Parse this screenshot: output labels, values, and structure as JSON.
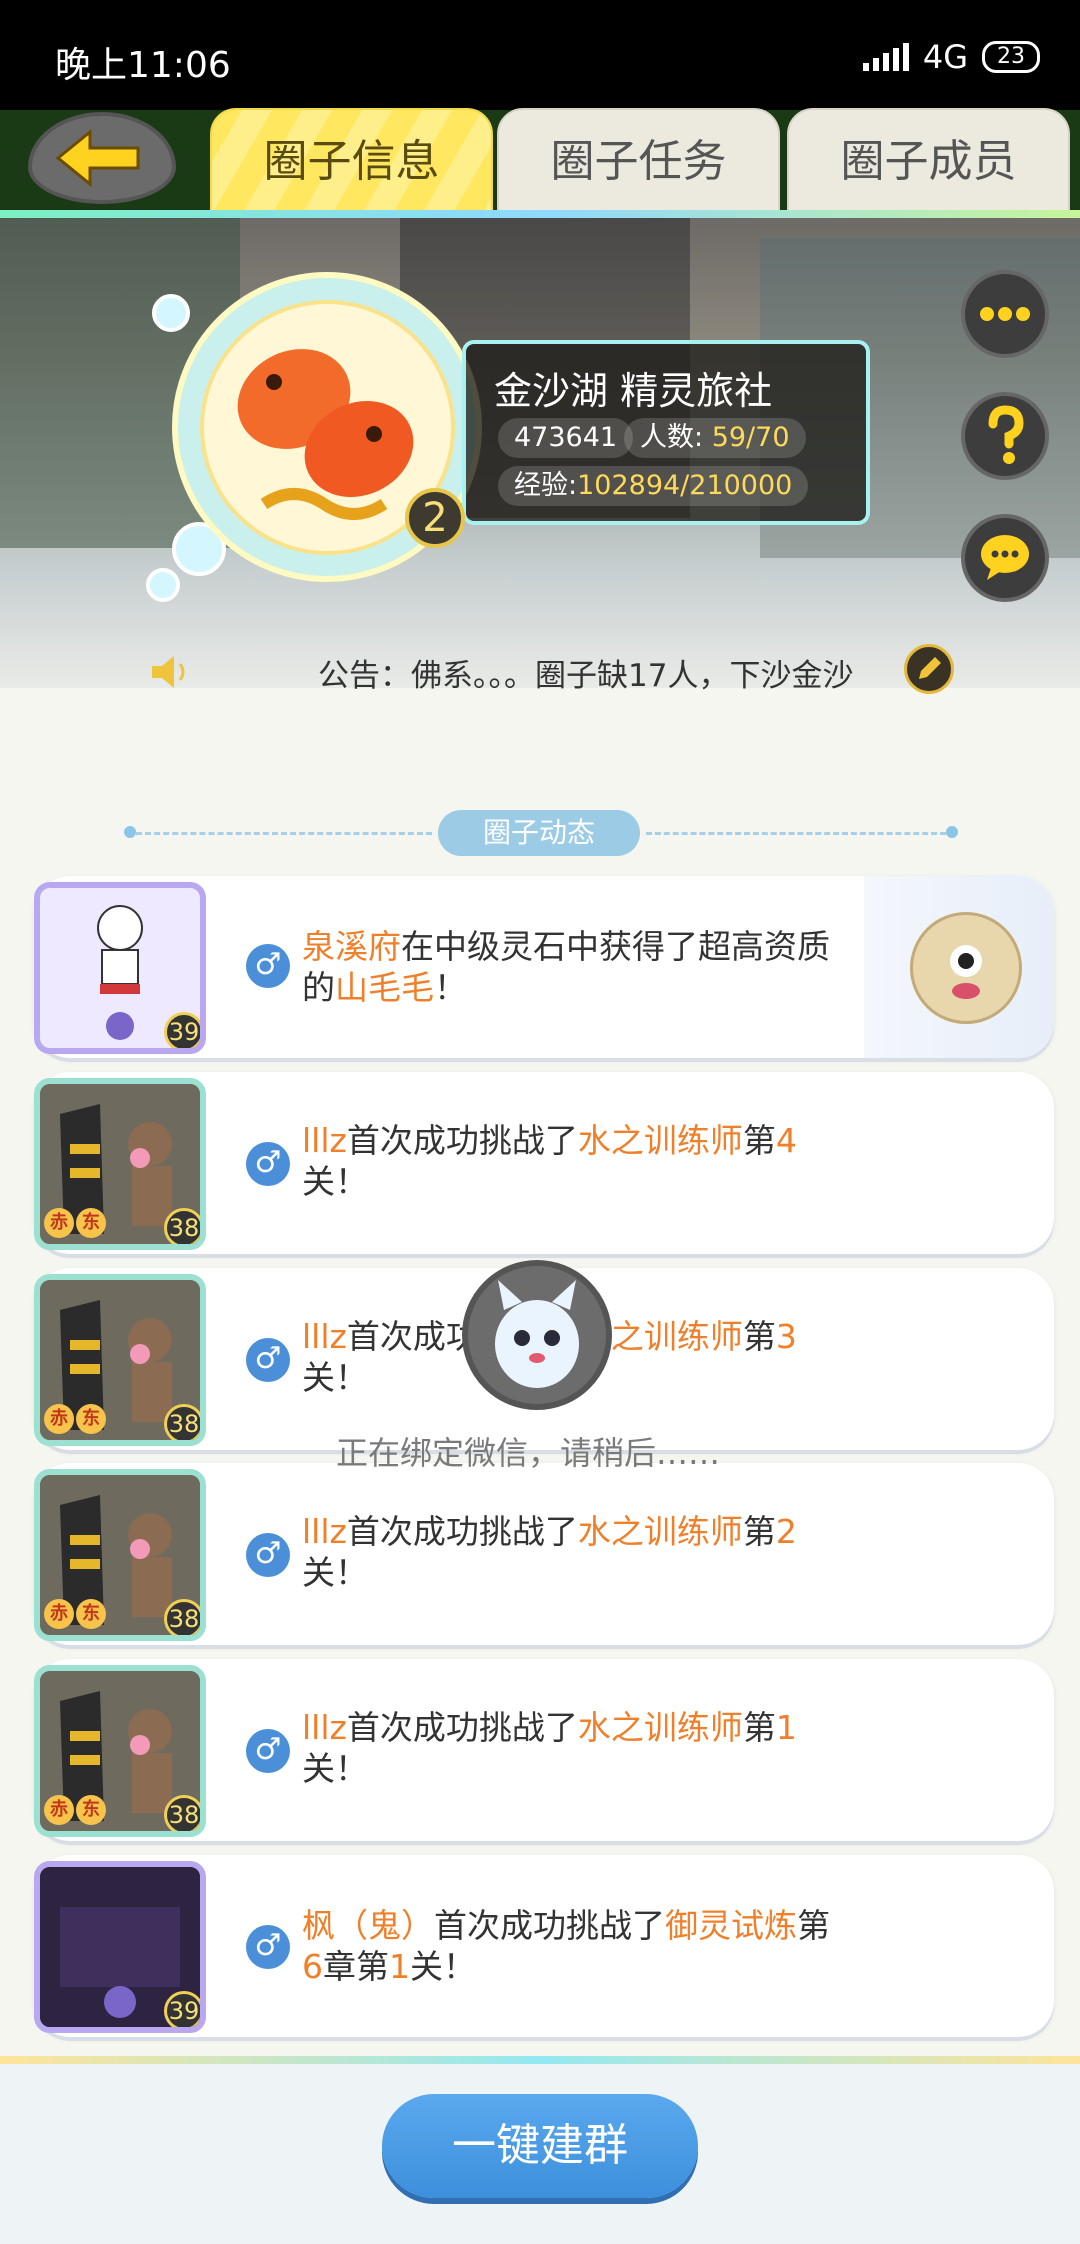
{
  "status_bar": {
    "time": "晚上11:06",
    "network": "4G",
    "battery": "23"
  },
  "tabs": [
    {
      "label": "圈子信息",
      "active": true
    },
    {
      "label": "圈子任务",
      "active": false
    },
    {
      "label": "圈子成员",
      "active": false
    }
  ],
  "club": {
    "level": "2",
    "name": "金沙湖 精灵旅社",
    "id": "473641",
    "members_label": "人数:",
    "members_value": "59/70",
    "exp_label": "经验:",
    "exp_value": "102894/210000",
    "notice": "公告：佛系。。。圈子缺17人，下沙金沙"
  },
  "section_title": "圈子动态",
  "feed": [
    {
      "level": "39",
      "parts": [
        [
          "泉溪府",
          true
        ],
        [
          "在中级灵石中获得了超高资质的",
          false
        ],
        [
          "山毛毛",
          true
        ],
        [
          "！",
          false
        ]
      ]
    },
    {
      "level": "38",
      "parts": [
        [
          "lllz",
          true
        ],
        [
          "首次成功挑战了",
          false
        ],
        [
          "水之训练师",
          true
        ],
        [
          "第",
          false
        ],
        [
          "4",
          true
        ],
        [
          "关！",
          false
        ]
      ]
    },
    {
      "level": "38",
      "parts": [
        [
          "lllz",
          true
        ],
        [
          "首次成功挑战了",
          false
        ],
        [
          "水之训练师",
          true
        ],
        [
          "第",
          false
        ],
        [
          "3",
          true
        ],
        [
          "关！",
          false
        ]
      ]
    },
    {
      "level": "38",
      "parts": [
        [
          "lllz",
          true
        ],
        [
          "首次成功挑战了",
          false
        ],
        [
          "水之训练师",
          true
        ],
        [
          "第",
          false
        ],
        [
          "2",
          true
        ],
        [
          "关！",
          false
        ]
      ]
    },
    {
      "level": "38",
      "parts": [
        [
          "lllz",
          true
        ],
        [
          "首次成功挑战了",
          false
        ],
        [
          "水之训练师",
          true
        ],
        [
          "第",
          false
        ],
        [
          "1",
          true
        ],
        [
          "关！",
          false
        ]
      ]
    },
    {
      "level": "39",
      "parts": [
        [
          "枫（鬼）",
          true
        ],
        [
          "首次成功挑战了",
          false
        ],
        [
          "御灵试炼",
          true
        ],
        [
          "第",
          false
        ],
        [
          "6",
          true
        ],
        [
          "章第",
          false
        ],
        [
          "1",
          true
        ],
        [
          "关！",
          false
        ]
      ]
    }
  ],
  "tag_chars": [
    "赤",
    "东"
  ],
  "gender_symbol": "♂",
  "loading_text": "正在绑定微信，请稍后……",
  "bottom_button": "一键建群"
}
